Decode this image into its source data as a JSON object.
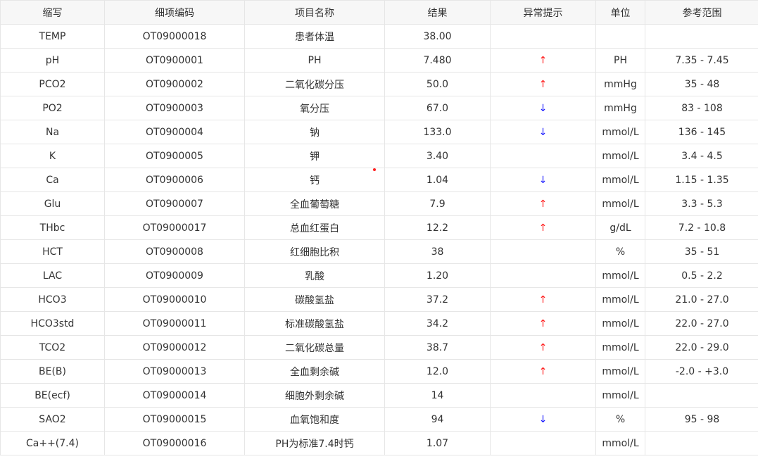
{
  "headers": {
    "abbr": "缩写",
    "code": "细项编码",
    "name": "项目名称",
    "result": "结果",
    "flag": "异常提示",
    "unit": "单位",
    "range": "参考范围"
  },
  "flag_colors": {
    "up": "#ff1a1a",
    "down": "#1a1aff"
  },
  "rows": [
    {
      "abbr": "TEMP",
      "code": "OT09000018",
      "name": "患者体温",
      "result": "38.00",
      "flag": "",
      "flag_type": "none",
      "unit": "",
      "range": ""
    },
    {
      "abbr": "pH",
      "code": "OT0900001",
      "name": "PH",
      "result": "7.480",
      "flag": "↑",
      "flag_type": "up",
      "unit": "PH",
      "range": "7.35 - 7.45"
    },
    {
      "abbr": "PCO2",
      "code": "OT0900002",
      "name": "二氧化碳分压",
      "result": "50.0",
      "flag": "↑",
      "flag_type": "up",
      "unit": "mmHg",
      "range": "35 - 48"
    },
    {
      "abbr": "PO2",
      "code": "OT0900003",
      "name": "氧分压",
      "result": "67.0",
      "flag": "↓",
      "flag_type": "down",
      "unit": "mmHg",
      "range": "83 - 108"
    },
    {
      "abbr": "Na",
      "code": "OT0900004",
      "name": "钠",
      "result": "133.0",
      "flag": "↓",
      "flag_type": "down",
      "unit": "mmol/L",
      "range": "136 - 145"
    },
    {
      "abbr": "K",
      "code": "OT0900005",
      "name": "钾",
      "result": "3.40",
      "flag": "",
      "flag_type": "none",
      "unit": "mmol/L",
      "range": "3.4 - 4.5"
    },
    {
      "abbr": "Ca",
      "code": "OT0900006",
      "name": "钙",
      "result": "1.04",
      "flag": "↓",
      "flag_type": "down",
      "unit": "mmol/L",
      "range": "1.15 - 1.35"
    },
    {
      "abbr": "Glu",
      "code": "OT0900007",
      "name": "全血葡萄糖",
      "result": "7.9",
      "flag": "↑",
      "flag_type": "up",
      "unit": "mmol/L",
      "range": "3.3 - 5.3"
    },
    {
      "abbr": "THbc",
      "code": "OT09000017",
      "name": "总血红蛋白",
      "result": "12.2",
      "flag": "↑",
      "flag_type": "up",
      "unit": "g/dL",
      "range": "7.2 - 10.8"
    },
    {
      "abbr": "HCT",
      "code": "OT0900008",
      "name": "红细胞比积",
      "result": "38",
      "flag": "",
      "flag_type": "none",
      "unit": "%",
      "range": "35 - 51"
    },
    {
      "abbr": "LAC",
      "code": "OT0900009",
      "name": "乳酸",
      "result": "1.20",
      "flag": "",
      "flag_type": "none",
      "unit": "mmol/L",
      "range": "0.5 - 2.2"
    },
    {
      "abbr": "HCO3",
      "code": "OT09000010",
      "name": "碳酸氢盐",
      "result": "37.2",
      "flag": "↑",
      "flag_type": "up",
      "unit": "mmol/L",
      "range": "21.0 - 27.0"
    },
    {
      "abbr": "HCO3std",
      "code": "OT09000011",
      "name": "标准碳酸氢盐",
      "result": "34.2",
      "flag": "↑",
      "flag_type": "up",
      "unit": "mmol/L",
      "range": "22.0 - 27.0"
    },
    {
      "abbr": "TCO2",
      "code": "OT09000012",
      "name": "二氧化碳总量",
      "result": "38.7",
      "flag": "↑",
      "flag_type": "up",
      "unit": "mmol/L",
      "range": "22.0 - 29.0"
    },
    {
      "abbr": "BE(B)",
      "code": "OT09000013",
      "name": "全血剩余碱",
      "result": "12.0",
      "flag": "↑",
      "flag_type": "up",
      "unit": "mmol/L",
      "range": "-2.0 - +3.0"
    },
    {
      "abbr": "BE(ecf)",
      "code": "OT09000014",
      "name": "细胞外剩余碱",
      "result": "14",
      "flag": "",
      "flag_type": "none",
      "unit": "mmol/L",
      "range": ""
    },
    {
      "abbr": "SAO2",
      "code": "OT09000015",
      "name": "血氧饱和度",
      "result": "94",
      "flag": "↓",
      "flag_type": "down",
      "unit": "%",
      "range": "95 - 98"
    },
    {
      "abbr": "Ca++(7.4)",
      "code": "OT09000016",
      "name": "PH为标准7.4时钙",
      "result": "1.07",
      "flag": "",
      "flag_type": "none",
      "unit": "mmol/L",
      "range": ""
    }
  ]
}
